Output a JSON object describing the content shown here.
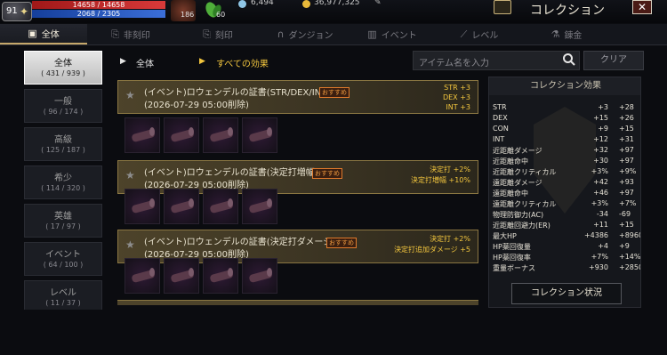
{
  "player": {
    "level": "91",
    "hp": "14658 / 14658",
    "mp": "2068 / 2305",
    "pet_count": "186",
    "leaf_count": "60",
    "currency_1": "6,494",
    "currency_2": "36,977,325"
  },
  "header": {
    "title": "コレクション",
    "close_label": "✕"
  },
  "tabs": [
    {
      "label": "全体",
      "icon": "book-icon"
    },
    {
      "label": "非刻印",
      "icon": "stamp-icon"
    },
    {
      "label": "刻印",
      "icon": "stamp-icon"
    },
    {
      "label": "ダンジョン",
      "icon": "dungeon-icon"
    },
    {
      "label": "イベント",
      "icon": "gift-icon"
    },
    {
      "label": "レベル",
      "icon": "level-icon"
    },
    {
      "label": "錬金",
      "icon": "alchemy-icon"
    }
  ],
  "categories": [
    {
      "name": "全体",
      "count": "( 431 / 939 )"
    },
    {
      "name": "一般",
      "count": "( 96 / 174 )"
    },
    {
      "name": "高級",
      "count": "( 125 / 187 )"
    },
    {
      "name": "希少",
      "count": "( 114 / 320 )"
    },
    {
      "name": "英雄",
      "count": "( 17 / 97 )"
    },
    {
      "name": "イベント",
      "count": "( 64 / 100 )"
    },
    {
      "name": "レベル",
      "count": "( 11 / 37 )"
    }
  ],
  "filters": {
    "category": "全体",
    "effect": "すべての効果",
    "search_placeholder": "アイテム名を入力",
    "clear_label": "クリア"
  },
  "collections": [
    {
      "name": "(イベント)ロウェンデルの証書(STR/DEX/INT)",
      "date": "(2026-07-29  05:00削除)",
      "badge": "おすすめ",
      "stats": [
        "STR  +3",
        "DEX  +3",
        "INT  +3"
      ]
    },
    {
      "name": "(イベント)ロウェンデルの証書(決定打増幅)",
      "date": "(2026-07-29  05:00削除)",
      "badge": "おすすめ",
      "stats": [
        "決定打  +2%",
        "決定打増幅  +10%"
      ]
    },
    {
      "name": "(イベント)ロウェンデルの証書(決定打ダメージ)",
      "date": "(2026-07-29  05:00削除)",
      "badge": "おすすめ",
      "stats": [
        "決定打  +2%",
        "決定打追加ダメージ  +5"
      ]
    }
  ],
  "effects_panel": {
    "title": "コレクション効果",
    "status_button": "コレクション状況",
    "rows": [
      {
        "name": "STR",
        "a": "+3",
        "b": "+28"
      },
      {
        "name": "DEX",
        "a": "+15",
        "b": "+26"
      },
      {
        "name": "CON",
        "a": "+9",
        "b": "+15"
      },
      {
        "name": "INT",
        "a": "+12",
        "b": "+31"
      },
      {
        "name": "近距離ダメージ",
        "a": "+32",
        "b": "+97"
      },
      {
        "name": "近距離命中",
        "a": "+30",
        "b": "+97"
      },
      {
        "name": "近距離クリティカル",
        "a": "+3%",
        "b": "+9%"
      },
      {
        "name": "遠距離ダメージ",
        "a": "+42",
        "b": "+93"
      },
      {
        "name": "遠距離命中",
        "a": "+46",
        "b": "+97"
      },
      {
        "name": "遠距離クリティカル",
        "a": "+3%",
        "b": "+7%"
      },
      {
        "name": "物理防御力(AC)",
        "a": "-34",
        "b": "-69"
      },
      {
        "name": "近距離回避力(ER)",
        "a": "+11",
        "b": "+15"
      },
      {
        "name": "最大HP",
        "a": "+4386",
        "b": "+8960"
      },
      {
        "name": "HP薬回復量",
        "a": "+4",
        "b": "+9"
      },
      {
        "name": "HP薬回復率",
        "a": "+7%",
        "b": "+14%"
      },
      {
        "name": "重量ボーナス",
        "a": "+930",
        "b": "+2850"
      }
    ]
  },
  "colors": {
    "accent": "#f3c63e",
    "hp": "#c02626",
    "mp": "#2c5cc4",
    "badge": "#e07a2c"
  }
}
